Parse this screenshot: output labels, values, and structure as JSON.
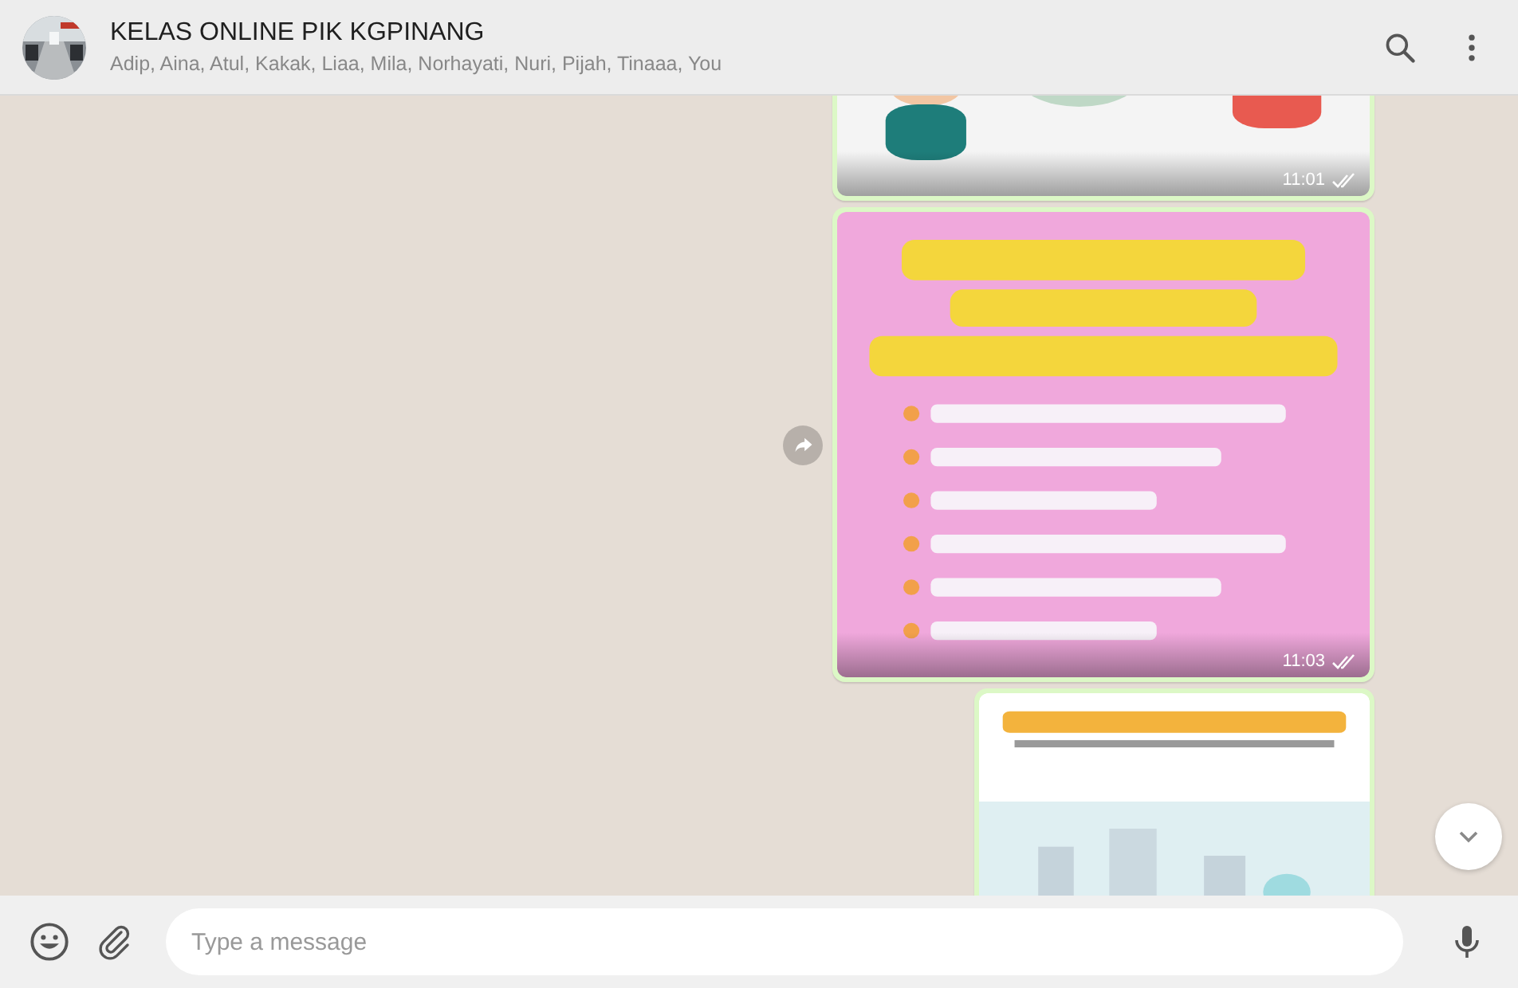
{
  "chat": {
    "title": "KELAS ONLINE PIK KGPINANG",
    "participants": "Adip, Aina, Atul, Kakak, Liaa, Mila, Norhayati, Nuri, Pijah, Tinaaa, You"
  },
  "messages": [
    {
      "kind": "picture",
      "time": "11:01",
      "read": false,
      "forward": false
    },
    {
      "kind": "picture",
      "time": "11:03",
      "read": false,
      "forward": true
    },
    {
      "kind": "picture",
      "forward": false
    }
  ],
  "composer": {
    "placeholder": "Type a message"
  }
}
